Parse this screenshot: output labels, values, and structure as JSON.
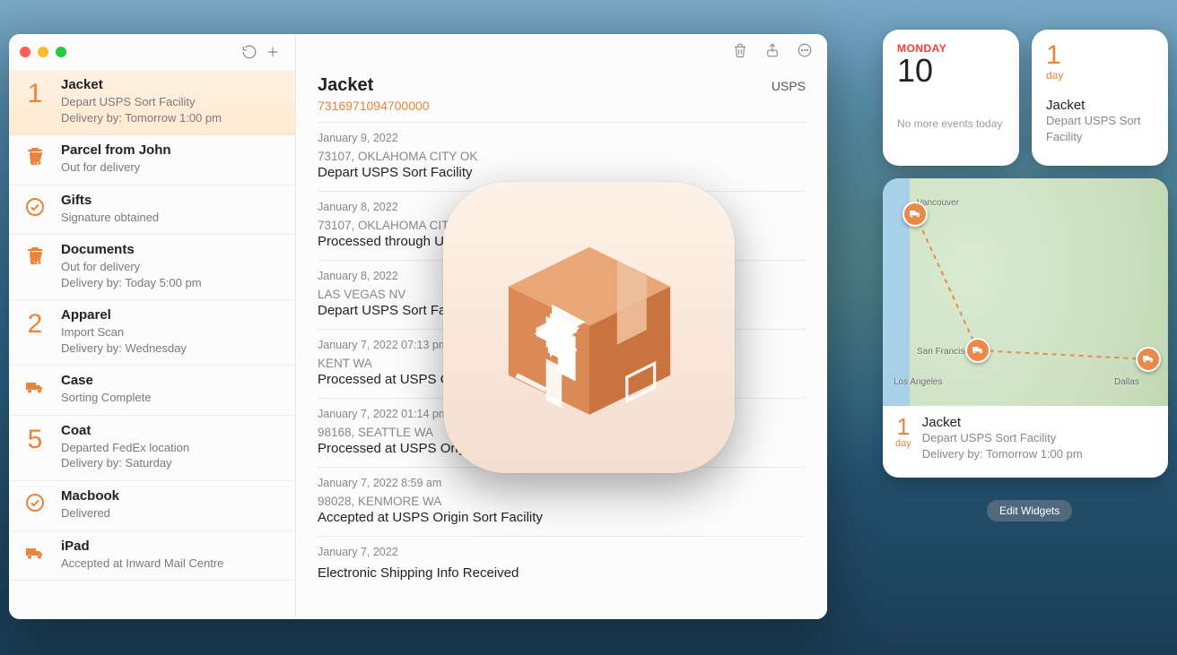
{
  "sidebar": {
    "items": [
      {
        "lead_kind": "days",
        "lead": "1",
        "title": "Jacket",
        "line1": "Depart USPS Sort Facility",
        "line2": "Delivery by: Tomorrow 1:00 pm",
        "selected": true
      },
      {
        "lead_kind": "cart",
        "title": "Parcel from John",
        "line1": "Out for delivery"
      },
      {
        "lead_kind": "check",
        "title": "Gifts",
        "line1": "Signature obtained"
      },
      {
        "lead_kind": "cart",
        "title": "Documents",
        "line1": "Out for delivery",
        "line2": "Delivery by: Today 5:00 pm"
      },
      {
        "lead_kind": "days",
        "lead": "2",
        "title": "Apparel",
        "line1": "Import Scan",
        "line2": "Delivery by: Wednesday"
      },
      {
        "lead_kind": "truck",
        "title": "Case",
        "line1": "Sorting Complete"
      },
      {
        "lead_kind": "days",
        "lead": "5",
        "title": "Coat",
        "line1": "Departed FedEx location",
        "line2": "Delivery by: Saturday"
      },
      {
        "lead_kind": "check",
        "title": "Macbook",
        "line1": "Delivered"
      },
      {
        "lead_kind": "truck",
        "title": "iPad",
        "line1": "Accepted at Inward Mail Centre"
      }
    ]
  },
  "detail": {
    "title": "Jacket",
    "tracking": "7316971094700000",
    "carrier": "USPS",
    "events": [
      {
        "date": "January 9, 2022",
        "loc": "73107, OKLAHOMA CITY OK",
        "status": "Depart USPS Sort Facility"
      },
      {
        "date": "January 8, 2022",
        "loc": "73107, OKLAHOMA CITY OK",
        "status": "Processed through USPS Sort Facility"
      },
      {
        "date": "January 8, 2022",
        "loc": "LAS VEGAS NV",
        "status": "Depart USPS Sort Facility"
      },
      {
        "date": "January 7, 2022 07:13 pm",
        "loc": "KENT WA",
        "status": "Processed at USPS Origin Sort Facility"
      },
      {
        "date": "January 7, 2022 01:14 pm",
        "loc": "98168, SEATTLE WA",
        "status": "Processed at USPS Origin Sort Facility"
      },
      {
        "date": "January 7, 2022 8:59 am",
        "loc": "98028, KENMORE WA",
        "status": "Accepted at USPS Origin Sort Facility"
      },
      {
        "date": "January 7, 2022",
        "loc": "",
        "status": "Electronic Shipping Info Received"
      }
    ]
  },
  "widgets": {
    "calendar": {
      "day": "MONDAY",
      "date": "10",
      "message": "No more events today"
    },
    "package_small": {
      "num": "1",
      "unit": "day",
      "title": "Jacket",
      "status": "Depart USPS Sort Facility"
    },
    "map": {
      "cities": {
        "vancouver": "Vancouver",
        "sf": "San Francisco",
        "la": "Los Angeles",
        "dallas": "Dallas"
      },
      "info": {
        "num": "1",
        "unit": "day",
        "title": "Jacket",
        "line1": "Depart USPS Sort Facility",
        "line2": "Delivery by: Tomorrow 1:00 pm"
      }
    },
    "edit_label": "Edit Widgets"
  }
}
